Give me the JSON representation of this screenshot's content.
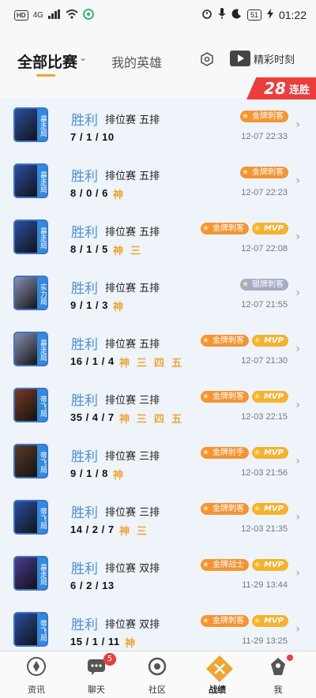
{
  "status_bar": {
    "left": {
      "hd": "HD",
      "network": "4G",
      "signal": "..ıl"
    },
    "time": "01:22",
    "battery": "51"
  },
  "header": {
    "tab_all_matches": "全部比赛",
    "tab_my_heroes": "我的英雄",
    "highlights_label": "精彩时刻",
    "streak_number": "28",
    "streak_label": "连胜"
  },
  "colors": {
    "accent": "#f0a531",
    "result_blue": "#4c8fe0",
    "badge_gold": "#f59433",
    "badge_silver": "#a5adc6",
    "streak_red": "#ec3d3d"
  },
  "matches": [
    {
      "hero_color": "#2c4f9e",
      "mode_tag": "暴走局",
      "result": "胜利",
      "mode": "排位赛 五排",
      "kda": "7 / 1 / 10",
      "gods": [],
      "badges": [
        {
          "type": "gold",
          "label": "金牌刺客"
        }
      ],
      "time": "12-07 22:33"
    },
    {
      "hero_color": "#2c4f9e",
      "mode_tag": "暴走局",
      "result": "胜利",
      "mode": "排位赛 五排",
      "kda": "8 / 0 / 6",
      "gods": [
        "神"
      ],
      "badges": [
        {
          "type": "gold",
          "label": "金牌刺客"
        }
      ],
      "time": "12-07 22:23"
    },
    {
      "hero_color": "#2c4f9e",
      "mode_tag": "暴走局",
      "result": "胜利",
      "mode": "排位赛 五排",
      "kda": "8 / 1 / 5",
      "gods": [
        "神",
        "三"
      ],
      "badges": [
        {
          "type": "gold",
          "label": "金牌刺客"
        },
        {
          "type": "mvp",
          "label": "MVP"
        }
      ],
      "time": "12-07 22:08"
    },
    {
      "hero_color": "#8a8fb0",
      "mode_tag": "实力局",
      "result": "胜利",
      "mode": "排位赛 五排",
      "kda": "9 / 1 / 3",
      "gods": [
        "神"
      ],
      "badges": [
        {
          "type": "silver",
          "label": "银牌刺客"
        }
      ],
      "time": "12-07 21:55"
    },
    {
      "hero_color": "#8a8fb0",
      "mode_tag": "暴走局",
      "result": "胜利",
      "mode": "排位赛 五排",
      "kda": "16 / 1 / 4",
      "gods": [
        "神",
        "三",
        "四",
        "五"
      ],
      "badges": [
        {
          "type": "gold",
          "label": "金牌刺客"
        },
        {
          "type": "mvp",
          "label": "MVP"
        }
      ],
      "time": "12-07 21:30"
    },
    {
      "hero_color": "#7a3a22",
      "mode_tag": "带飞局",
      "result": "胜利",
      "mode": "排位赛 三排",
      "kda": "35 / 4 / 7",
      "gods": [
        "神",
        "三",
        "四",
        "五"
      ],
      "badges": [
        {
          "type": "gold",
          "label": "金牌刺客"
        },
        {
          "type": "mvp",
          "label": "MVP"
        }
      ],
      "time": "12-03 22:15"
    },
    {
      "hero_color": "#5a3a28",
      "mode_tag": "带飞局",
      "result": "胜利",
      "mode": "排位赛 三排",
      "kda": "9 / 1 / 8",
      "gods": [
        "神"
      ],
      "badges": [
        {
          "type": "gold",
          "label": "金牌射手"
        },
        {
          "type": "mvp",
          "label": "MVP"
        }
      ],
      "time": "12-03 21:56"
    },
    {
      "hero_color": "#2c4f9e",
      "mode_tag": "带飞局",
      "result": "胜利",
      "mode": "排位赛 三排",
      "kda": "14 / 2 / 7",
      "gods": [
        "神",
        "三"
      ],
      "badges": [
        {
          "type": "gold",
          "label": "金牌刺客"
        },
        {
          "type": "mvp",
          "label": "MVP"
        }
      ],
      "time": "12-03 21:35"
    },
    {
      "hero_color": "#4a3a8e",
      "mode_tag": "暴走局",
      "result": "胜利",
      "mode": "排位赛 双排",
      "kda": "6 / 2 / 13",
      "gods": [],
      "badges": [
        {
          "type": "gold",
          "label": "金牌战士"
        },
        {
          "type": "mvp",
          "label": "MVP"
        }
      ],
      "time": "11-29 13:44"
    },
    {
      "hero_color": "#2c4f9e",
      "mode_tag": "带飞局",
      "result": "胜利",
      "mode": "排位赛 双排",
      "kda": "15 / 1 / 11",
      "gods": [
        "神"
      ],
      "badges": [
        {
          "type": "gold",
          "label": "金牌刺客"
        },
        {
          "type": "mvp",
          "label": "MVP"
        }
      ],
      "time": "11-29 13:25"
    }
  ],
  "tabbar": [
    {
      "label": "资讯",
      "icon": "news-icon",
      "badge": ""
    },
    {
      "label": "聊天",
      "icon": "chat-icon",
      "badge": "5"
    },
    {
      "label": "社区",
      "icon": "community-icon",
      "badge": ""
    },
    {
      "label": "战绩",
      "icon": "battle-record-icon",
      "badge": "",
      "active": true
    },
    {
      "label": "我",
      "icon": "profile-icon",
      "badge": "",
      "dot": true
    }
  ]
}
